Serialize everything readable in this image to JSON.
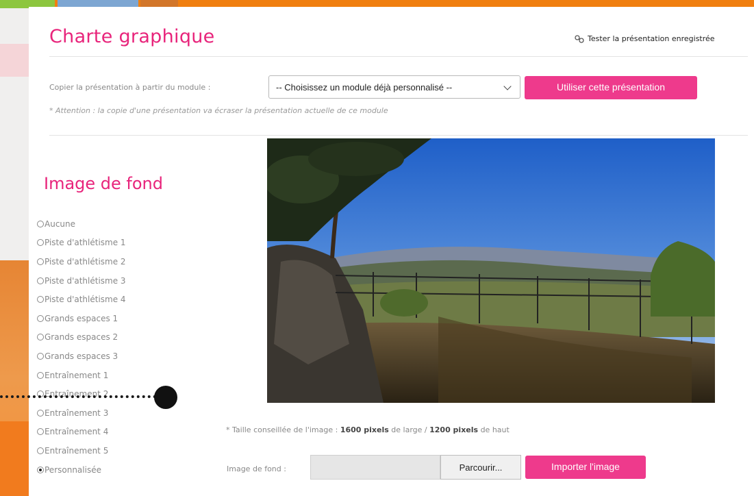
{
  "page": {
    "title": "Charte graphique",
    "test_link": "Tester la présentation enregistrée"
  },
  "copy": {
    "label": "Copier la présentation à partir du module :",
    "select_value": "-- Choisissez un module déjà personnalisé --",
    "button": "Utiliser cette présentation",
    "warning": "* Attention : la copie d'une présentation va écraser la présentation actuelle de ce module"
  },
  "background": {
    "title": "Image de fond",
    "options": [
      {
        "label": "Aucune",
        "selected": false
      },
      {
        "label": "Piste d'athlétisme 1",
        "selected": false
      },
      {
        "label": "Piste d'athlétisme 2",
        "selected": false
      },
      {
        "label": "Piste d'athlétisme 3",
        "selected": false
      },
      {
        "label": "Piste d'athlétisme 4",
        "selected": false
      },
      {
        "label": "Grands espaces 1",
        "selected": false
      },
      {
        "label": "Grands espaces 2",
        "selected": false
      },
      {
        "label": "Grands espaces 3",
        "selected": false
      },
      {
        "label": "Entraînement 1",
        "selected": false
      },
      {
        "label": "Entraînement 2",
        "selected": false
      },
      {
        "label": "Entraînement 3",
        "selected": false
      },
      {
        "label": "Entraînement 4",
        "selected": false
      },
      {
        "label": "Entraînement 5",
        "selected": false
      },
      {
        "label": "Personnalisée",
        "selected": true
      }
    ],
    "size_note": {
      "prefix": "* Taille conseillée de l'image :",
      "width": "1600 pixels",
      "middle": "de large /",
      "height": "1200 pixels",
      "suffix": "de haut"
    },
    "file_label": "Image de fond :",
    "browse": "Parcourir...",
    "import_button": "Importer l'image"
  },
  "icons": {
    "test_link": "link-icon"
  },
  "colors": {
    "accent": "#e8247b",
    "button": "#ee3a8c",
    "top_bar": "#f07f0f"
  }
}
